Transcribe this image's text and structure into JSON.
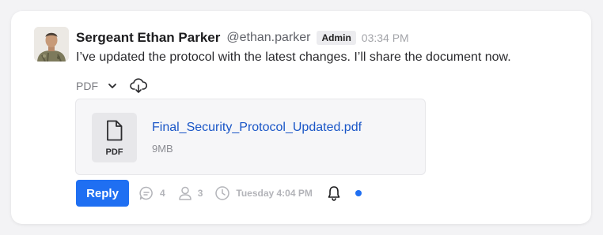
{
  "message": {
    "author": {
      "name": "Sergeant Ethan Parker",
      "handle": "@ethan.parker",
      "role_badge": "Admin",
      "avatar_icon": "soldier-avatar"
    },
    "time": "03:34 PM",
    "text": "I’ve updated the protocol with the latest changes. I’ll share the document now.",
    "attachment": {
      "type_label": "PDF",
      "chevron_icon": "chevron-down-icon",
      "download_icon": "cloud-download-icon",
      "file": {
        "name": "Final_Security_Protocol_Updated.pdf",
        "size": "9MB",
        "extension": "PDF",
        "icon": "file-icon"
      }
    },
    "actions": {
      "reply_label": "Reply",
      "replies_count": "4",
      "participants_count": "3",
      "last_reply": "Tuesday 4:04 PM",
      "bell_icon": "bell-icon",
      "unread_indicator_color": "#1f6ff2"
    }
  },
  "colors": {
    "accent": "#1f6ff2",
    "link": "#1a56c7",
    "muted": "#a3a4a9"
  }
}
